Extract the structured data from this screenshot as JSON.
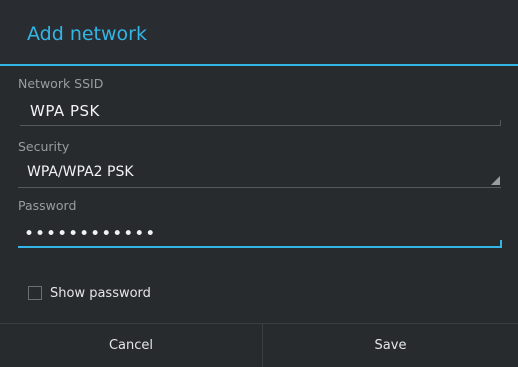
{
  "dialog": {
    "title": "Add network",
    "accent_color": "#33b5e5",
    "background_color": "#272b2e"
  },
  "fields": {
    "ssid": {
      "label": "Network SSID",
      "value": "WPA  PSK"
    },
    "security": {
      "label": "Security",
      "value": "WPA/WPA2 PSK"
    },
    "password": {
      "label": "Password",
      "value": "••••••••••••"
    }
  },
  "options": {
    "show_password": {
      "label": "Show password",
      "checked": false
    }
  },
  "buttons": {
    "cancel": "Cancel",
    "save": "Save"
  }
}
